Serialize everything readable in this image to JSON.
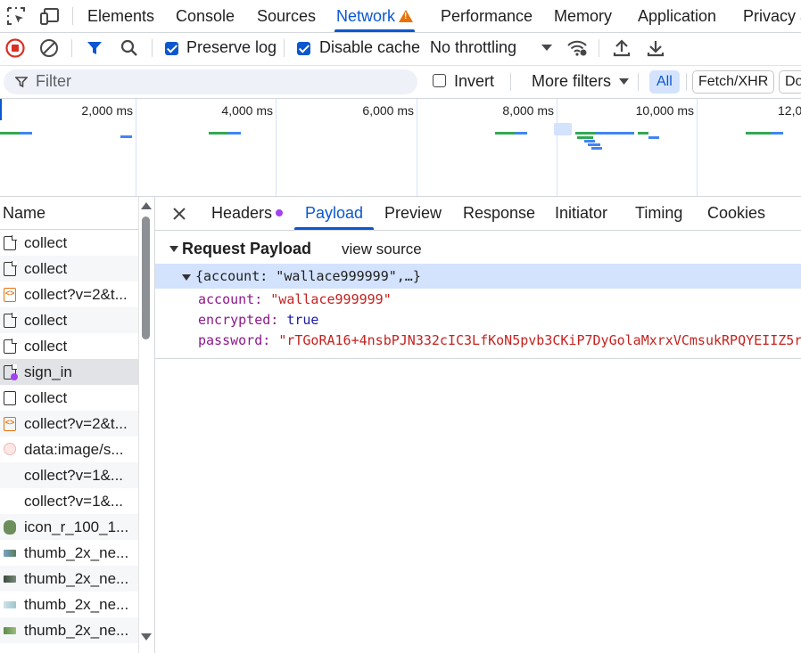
{
  "tabs": {
    "items": [
      "Elements",
      "Console",
      "Sources",
      "Network",
      "Performance",
      "Memory",
      "Application",
      "Privacy a"
    ],
    "active": "Network"
  },
  "toolbar": {
    "preserve_log": "Preserve log",
    "disable_cache": "Disable cache",
    "throttling": "No throttling"
  },
  "filter": {
    "placeholder": "Filter",
    "invert": "Invert",
    "more_filters": "More filters",
    "all": "All",
    "fetch_xhr": "Fetch/XHR",
    "doc": "Do"
  },
  "overview": {
    "ticks": [
      "2,000 ms",
      "4,000 ms",
      "6,000 ms",
      "8,000 ms",
      "10,000 ms",
      "12,0"
    ]
  },
  "list": {
    "header": "Name",
    "rows": [
      {
        "name": "collect",
        "icon": "document-icon"
      },
      {
        "name": "collect",
        "icon": "document-icon"
      },
      {
        "name": "collect?v=2&t...",
        "icon": "script-icon"
      },
      {
        "name": "collect",
        "icon": "document-icon"
      },
      {
        "name": "collect",
        "icon": "document-icon"
      },
      {
        "name": "sign_in",
        "icon": "fetch-document-icon"
      },
      {
        "name": "collect",
        "icon": "blank-icon"
      },
      {
        "name": "collect?v=2&t...",
        "icon": "script-icon"
      },
      {
        "name": "data:image/s...",
        "icon": "image-icon"
      },
      {
        "name": "collect?v=1&...",
        "icon": "none"
      },
      {
        "name": "collect?v=1&...",
        "icon": "none"
      },
      {
        "name": "icon_r_100_1...",
        "icon": "thumbnail-icon"
      },
      {
        "name": "thumb_2x_ne...",
        "icon": "thumbnail-icon"
      },
      {
        "name": "thumb_2x_ne...",
        "icon": "thumbnail-icon"
      },
      {
        "name": "thumb_2x_ne...",
        "icon": "thumbnail-icon"
      },
      {
        "name": "thumb_2x_ne...",
        "icon": "thumbnail-icon"
      }
    ]
  },
  "detail": {
    "tabs": [
      "Headers",
      "Payload",
      "Preview",
      "Response",
      "Initiator",
      "Timing",
      "Cookies"
    ],
    "active": "Payload"
  },
  "payload": {
    "title": "Request Payload",
    "view_source": "view source",
    "summary": "{account: \"wallace999999\",…}",
    "fields": [
      {
        "key": "account",
        "value": "\"wallace999999\"",
        "kind": "string"
      },
      {
        "key": "encrypted",
        "value": "true",
        "kind": "bool"
      },
      {
        "key": "password",
        "value": "\"rTGoRA16+4nsbPJN332cIC3LfKoN5pvb3CKiP7DyGolaMxrxVCmsukRPQYEIIZ5r",
        "kind": "string"
      }
    ]
  },
  "colors": {
    "accent": "#0b57d0",
    "record_red": "#d93025",
    "string_red": "#c5221f",
    "warning_orange": "#e8710a"
  }
}
